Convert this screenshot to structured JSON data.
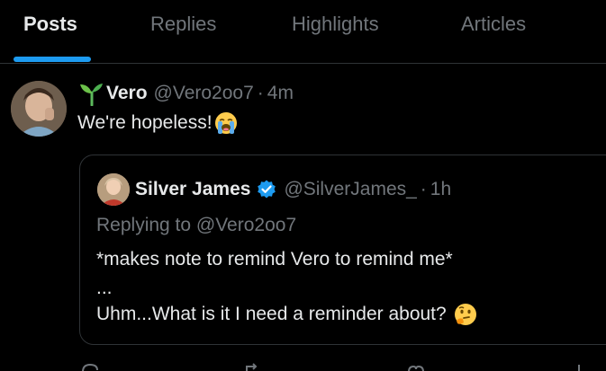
{
  "tabs": [
    {
      "label": "Posts",
      "active": true
    },
    {
      "label": "Replies",
      "active": false
    },
    {
      "label": "Highlights",
      "active": false
    },
    {
      "label": "Articles",
      "active": false
    }
  ],
  "accent_color": "#1d9bf0",
  "post": {
    "name": "Vero",
    "handle": "@Vero2oo7",
    "time": "4m",
    "separator": "·",
    "text": "We're hopeless!",
    "emoji": "loudly-crying-face-emoji",
    "name_icon": "sprout-icon"
  },
  "quote": {
    "name": "Silver James",
    "verified_icon": "verified-badge-icon",
    "handle": "@SilverJames_",
    "time": "1h",
    "separator": "·",
    "replying_to": "Replying to @Vero2oo7",
    "line1": "*makes note to remind Vero to remind me*",
    "line2": "...",
    "line3": "Uhm...What is it I need a reminder about?",
    "line3_emoji": "thinking-face-emoji"
  },
  "actions": [
    "reply-icon",
    "repost-icon",
    "like-icon",
    "views-icon"
  ]
}
